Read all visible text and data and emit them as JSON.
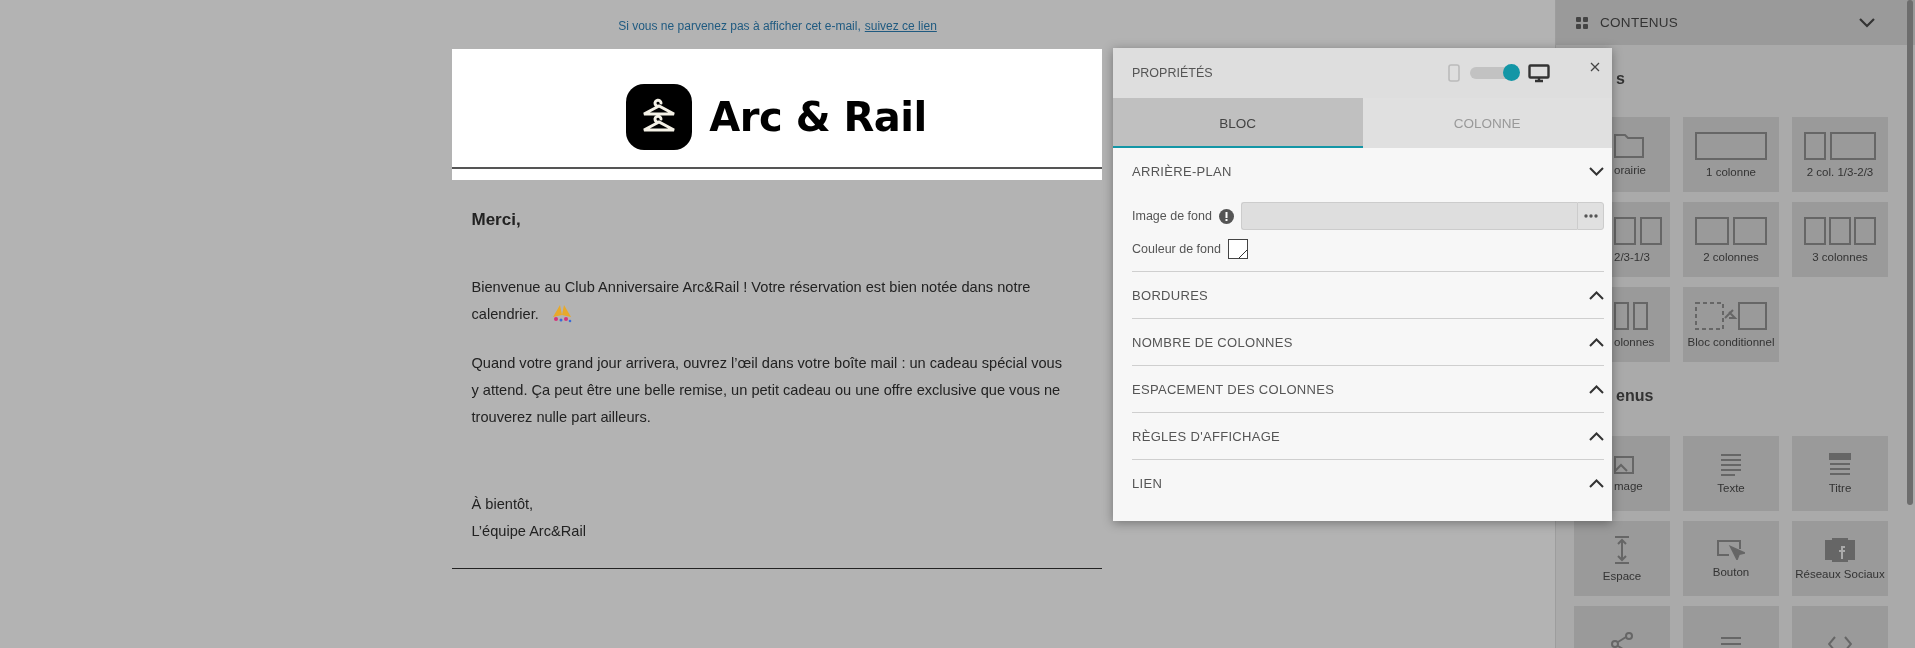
{
  "preheader": {
    "text": "Si vous ne parvenez pas à afficher cet e-mail,",
    "link": "suivez ce lien"
  },
  "email": {
    "brand": "Arc & Rail",
    "greeting": "Merci,",
    "paragraphs": [
      {
        "text": "Bienvenue au Club Anniversaire Arc&Rail ! Votre réservation est bien notée dans notre calendrier.",
        "confetti": true
      },
      {
        "text": "Quand votre grand jour arrivera, ouvrez l’œil dans votre boîte mail : un cadeau spécial vous y attend. Ça peut être une belle remise, un petit cadeau ou une offre exclusive que vous ne trouverez nulle part ailleurs.",
        "confetti": false
      }
    ],
    "signoff": [
      "À bientôt,",
      "L’équipe Arc&Rail"
    ]
  },
  "properties_panel": {
    "title": "PROPRIÉTÉS",
    "view_toggle": {
      "on": true
    },
    "tabs": [
      {
        "label": "BLOC",
        "selected": true
      },
      {
        "label": "COLONNE",
        "selected": false
      }
    ],
    "sections": [
      {
        "title": "ARRIÈRE-PLAN",
        "expanded": true,
        "fields": [
          {
            "kind": "file",
            "label": "Image de fond"
          },
          {
            "kind": "color",
            "label": "Couleur de fond"
          }
        ]
      },
      {
        "title": "BORDURES",
        "expanded": false
      },
      {
        "title": "NOMBRE DE COLONNES",
        "expanded": false
      },
      {
        "title": "ESPACEMENT DES COLONNES",
        "expanded": false
      },
      {
        "title": "RÈGLES D'AFFICHAGE",
        "expanded": false
      },
      {
        "title": "LIEN",
        "expanded": false
      }
    ]
  },
  "sidebar": {
    "title": "CONTENUS",
    "sections": [
      {
        "title": "s",
        "tiles": [
          {
            "kind": "folder",
            "label": "orairie",
            "covered": true
          },
          {
            "kind": "col1",
            "label": "1 colonne",
            "covered": false
          },
          {
            "kind": "col13",
            "label": "2 col. 1/3-2/3",
            "covered": false
          },
          {
            "kind": "col31",
            "label": "2/3-1/3",
            "covered": true
          },
          {
            "kind": "col2",
            "label": "2 colonnes",
            "covered": false
          },
          {
            "kind": "col3",
            "label": "3 colonnes",
            "covered": false
          },
          {
            "kind": "col4",
            "label": "olonnes",
            "covered": true
          },
          {
            "kind": "conditional",
            "label": "Bloc conditionnel",
            "covered": false
          }
        ]
      },
      {
        "title": "enus",
        "tiles": [
          {
            "kind": "image",
            "label": "mage",
            "covered": true
          },
          {
            "kind": "text",
            "label": "Texte",
            "covered": false
          },
          {
            "kind": "title",
            "label": "Titre",
            "covered": false
          },
          {
            "kind": "spacer",
            "label": "Espace",
            "covered": false
          },
          {
            "kind": "button",
            "label": "Bouton",
            "covered": false
          },
          {
            "kind": "social",
            "label": "Réseaux Sociaux",
            "covered": false
          },
          {
            "kind": "share",
            "covered": false
          },
          {
            "kind": "divider",
            "covered": false
          },
          {
            "kind": "code",
            "covered": false
          }
        ]
      }
    ]
  }
}
